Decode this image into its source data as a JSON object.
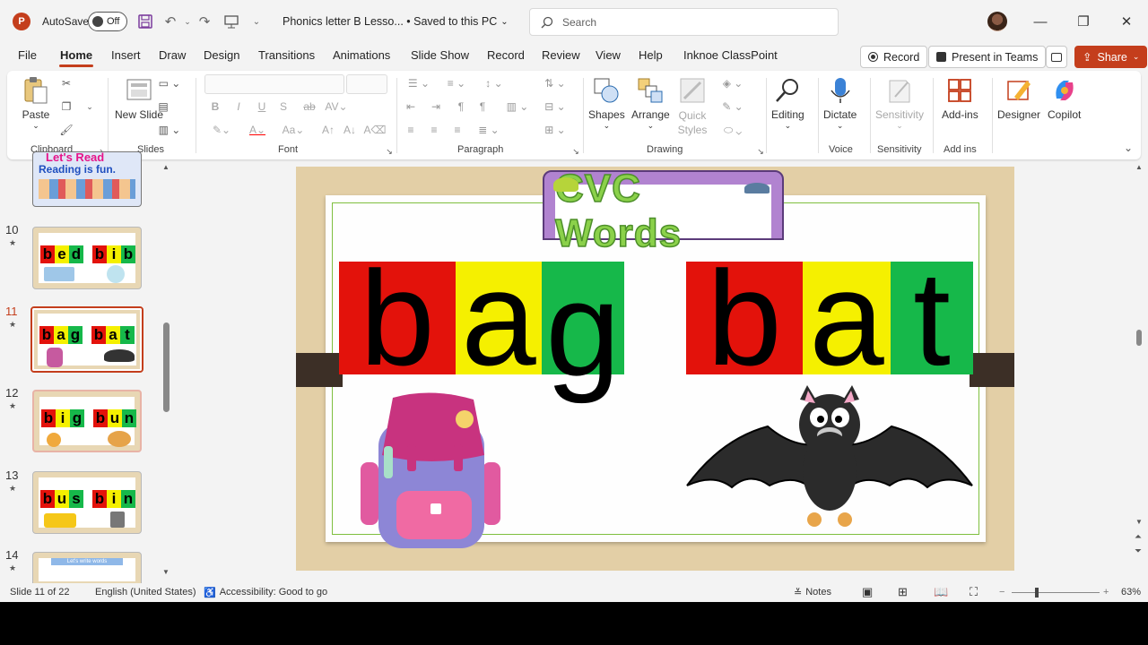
{
  "titlebar": {
    "app_icon": "powerpoint-logo",
    "app_letter": "P",
    "autosave_label": "AutoSave",
    "autosave_state": "Off",
    "doc_title": "Phonics letter B Lesso... • Saved to this PC",
    "search_placeholder": "Search",
    "window_controls": [
      "minimize-icon",
      "restore-icon",
      "close-icon"
    ]
  },
  "menu": {
    "tabs": [
      "File",
      "Home",
      "Insert",
      "Draw",
      "Design",
      "Transitions",
      "Animations",
      "Slide Show",
      "Record",
      "Review",
      "View",
      "Help",
      "Inknoe ClassPoint"
    ],
    "active_tab": "Home",
    "record_button": "Record",
    "present_button": "Present in Teams",
    "share_button": "Share"
  },
  "ribbon": {
    "groups": [
      "Clipboard",
      "Slides",
      "Font",
      "Paragraph",
      "Drawing",
      "Voice",
      "Sensitivity",
      "Add ins"
    ],
    "paste": "Paste",
    "new_slide": "New Slide",
    "shapes": "Shapes",
    "arrange": "Arrange",
    "quick_styles": "Quick Styles",
    "editing": "Editing",
    "dictate": "Dictate",
    "sensitivity": "Sensitivity",
    "addins": "Add-ins",
    "designer": "Designer",
    "copilot": "Copilot"
  },
  "slides_panel": {
    "items": [
      {
        "number": "10",
        "words": [
          "bed",
          "bib"
        ]
      },
      {
        "number": "11",
        "words": [
          "bag",
          "bat"
        ],
        "selected": true
      },
      {
        "number": "12",
        "words": [
          "big",
          "bun"
        ]
      },
      {
        "number": "13",
        "words": [
          "bus",
          "bin"
        ]
      },
      {
        "number": "14",
        "words": []
      }
    ],
    "top_thumb_text": [
      "Let's Read",
      "Reading is fun."
    ],
    "slide14_text": "Let's write words"
  },
  "slide": {
    "banner_title": "CVC Words",
    "word1": [
      "b",
      "a",
      "g"
    ],
    "word2": [
      "b",
      "a",
      "t"
    ],
    "images": [
      "backpack-image",
      "bat-image"
    ],
    "colors": {
      "red": "#e3120b",
      "yellow": "#f5f000",
      "green": "#16b84a"
    }
  },
  "status": {
    "slide_counter": "Slide 11 of 22",
    "language": "English (United States)",
    "accessibility": "Accessibility: Good to go",
    "notes": "Notes",
    "zoom": "63%"
  }
}
